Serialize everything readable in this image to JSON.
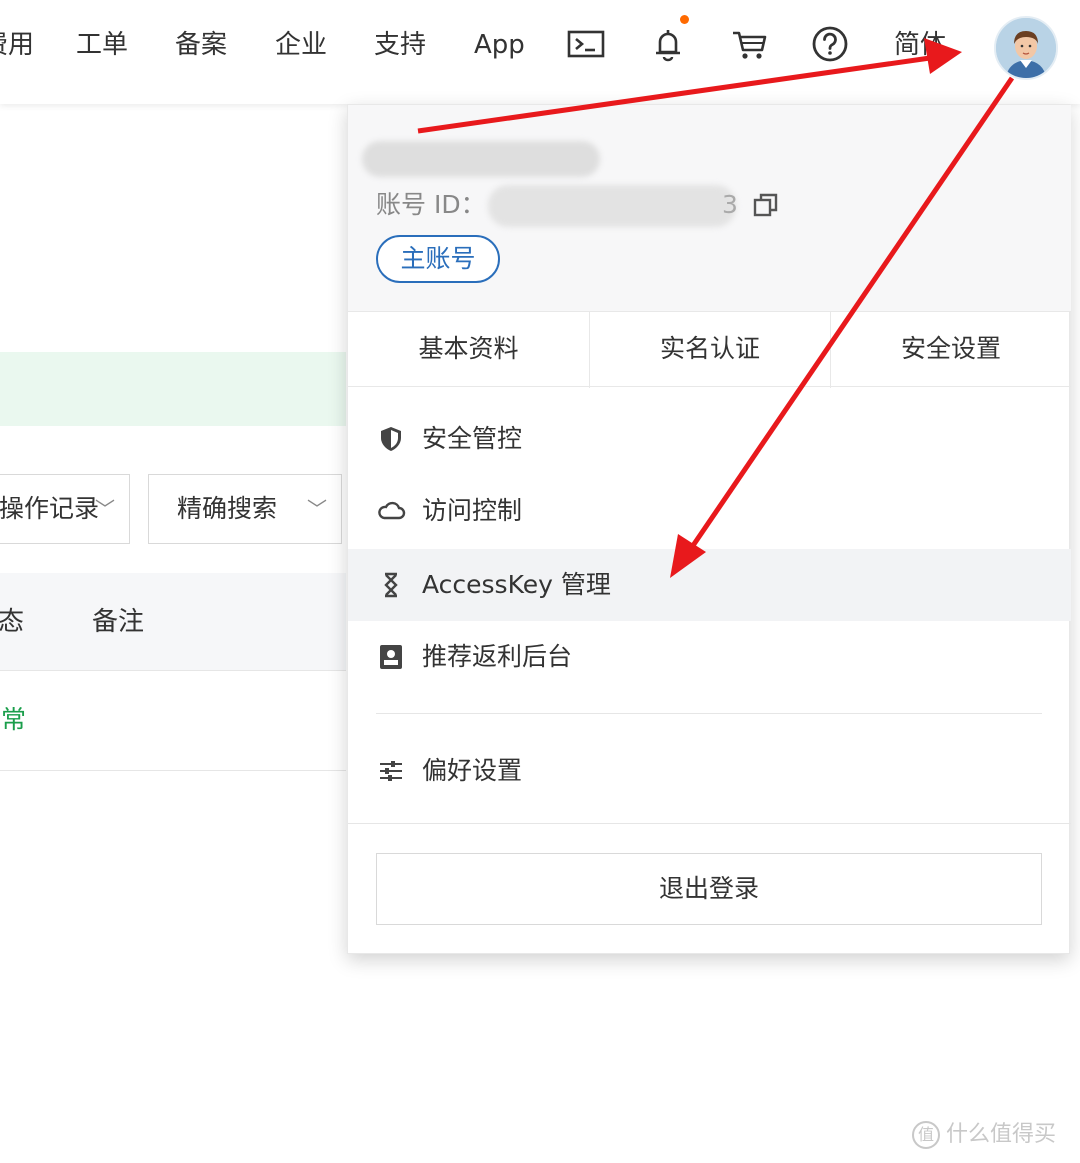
{
  "topnav": {
    "items": [
      "费用",
      "工单",
      "备案",
      "企业",
      "支持",
      "App"
    ],
    "icons": [
      "terminal-icon",
      "bell-icon",
      "cart-icon",
      "help-icon"
    ],
    "language": "简体",
    "notification_dot_color": "#ff6a00"
  },
  "background": {
    "filters": [
      "操作记录",
      "精确搜索"
    ],
    "table_headers": [
      "状态",
      "备注"
    ],
    "row_status": "正常",
    "status_color": "#1a9e4b"
  },
  "dropdown": {
    "account_id_label": "账号 ID：",
    "account_id_tail": "3",
    "badge": "主账号",
    "tabs": [
      "基本资料",
      "实名认证",
      "安全设置"
    ],
    "menu": [
      {
        "label": "安全管控",
        "icon": "shield-icon"
      },
      {
        "label": "访问控制",
        "icon": "cloud-icon"
      },
      {
        "label": "AccessKey 管理",
        "icon": "key-icon",
        "active": true
      },
      {
        "label": "推荐返利后台",
        "icon": "referral-icon"
      }
    ],
    "preferences": "偏好设置",
    "logout": "退出登录",
    "badge_color": "#2a6ebb"
  },
  "annotation_color": "#e8191c",
  "watermark": {
    "symbol": "值",
    "text": "什么值得买"
  }
}
